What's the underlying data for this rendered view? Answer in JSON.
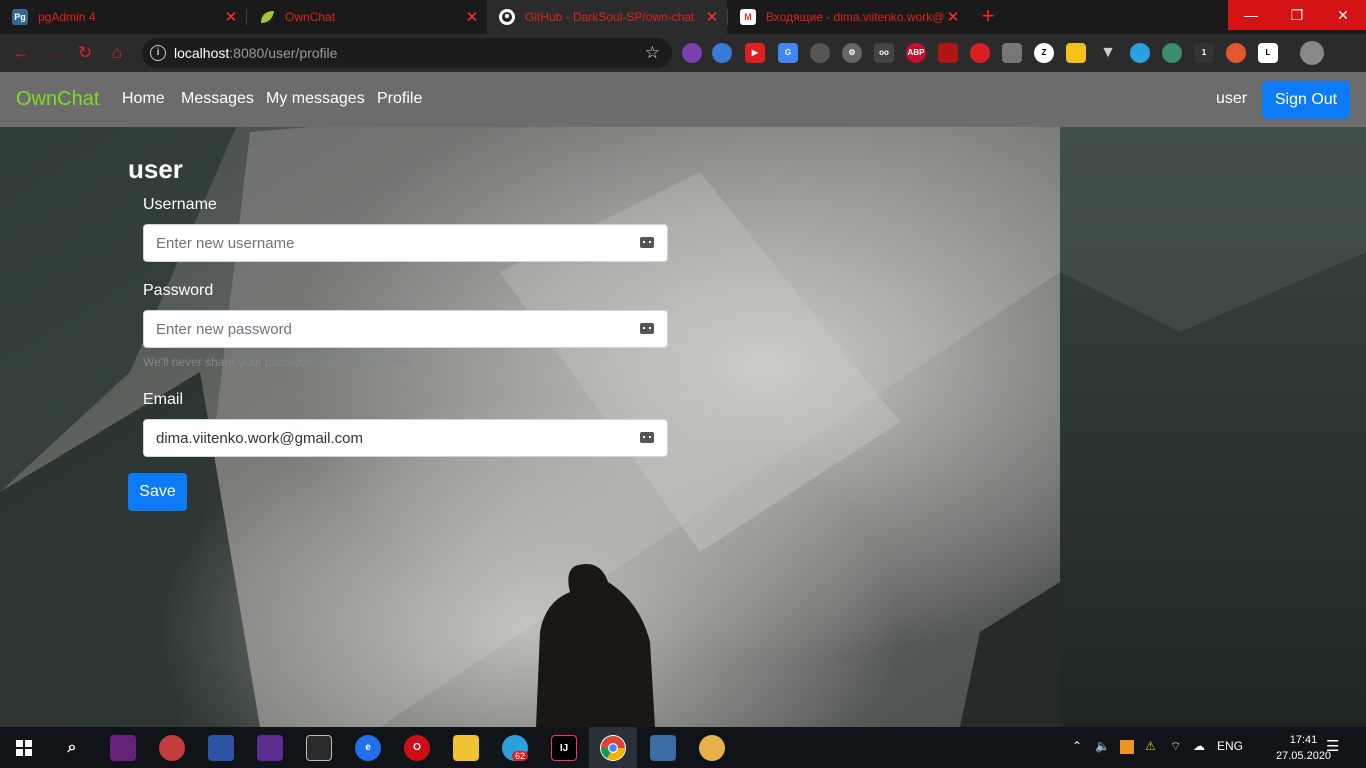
{
  "browser": {
    "tabs": [
      {
        "title": "pgAdmin 4",
        "favicon": "pgadmin-icon",
        "favicon_text": "Pg"
      },
      {
        "title": "OwnChat",
        "favicon": "leaf-icon",
        "favicon_text": ""
      },
      {
        "title": "GitHub - DarkSoul-SP/own-chat",
        "favicon": "github-icon",
        "favicon_text": ""
      },
      {
        "title": "Входящие - dima.viitenko.work@",
        "favicon": "gmail-icon",
        "favicon_text": "M"
      }
    ],
    "active_tab": 2,
    "address": {
      "host": "localhost",
      "rest": ":8080/user/profile"
    },
    "accent_color": "#e02020"
  },
  "navbar": {
    "brand": "OwnChat",
    "links": [
      "Home",
      "Messages",
      "My messages",
      "Profile"
    ],
    "user": "user",
    "signout": "Sign Out",
    "brand_color": "#7ddb25"
  },
  "profile": {
    "title": "user",
    "username": {
      "label": "Username",
      "placeholder": "Enter new username",
      "value": ""
    },
    "password": {
      "label": "Password",
      "placeholder": "Enter new password",
      "value": "",
      "help": "We'll never share your password with anyone else."
    },
    "email": {
      "label": "Email",
      "placeholder": "",
      "value": "dima.viitenko.work@gmail.com"
    },
    "save": "Save",
    "button_color": "#0c7bf5"
  },
  "taskbar": {
    "language": "ENG",
    "time": "17:41",
    "date": "27.05.2020",
    "telegram_badge": "62"
  }
}
